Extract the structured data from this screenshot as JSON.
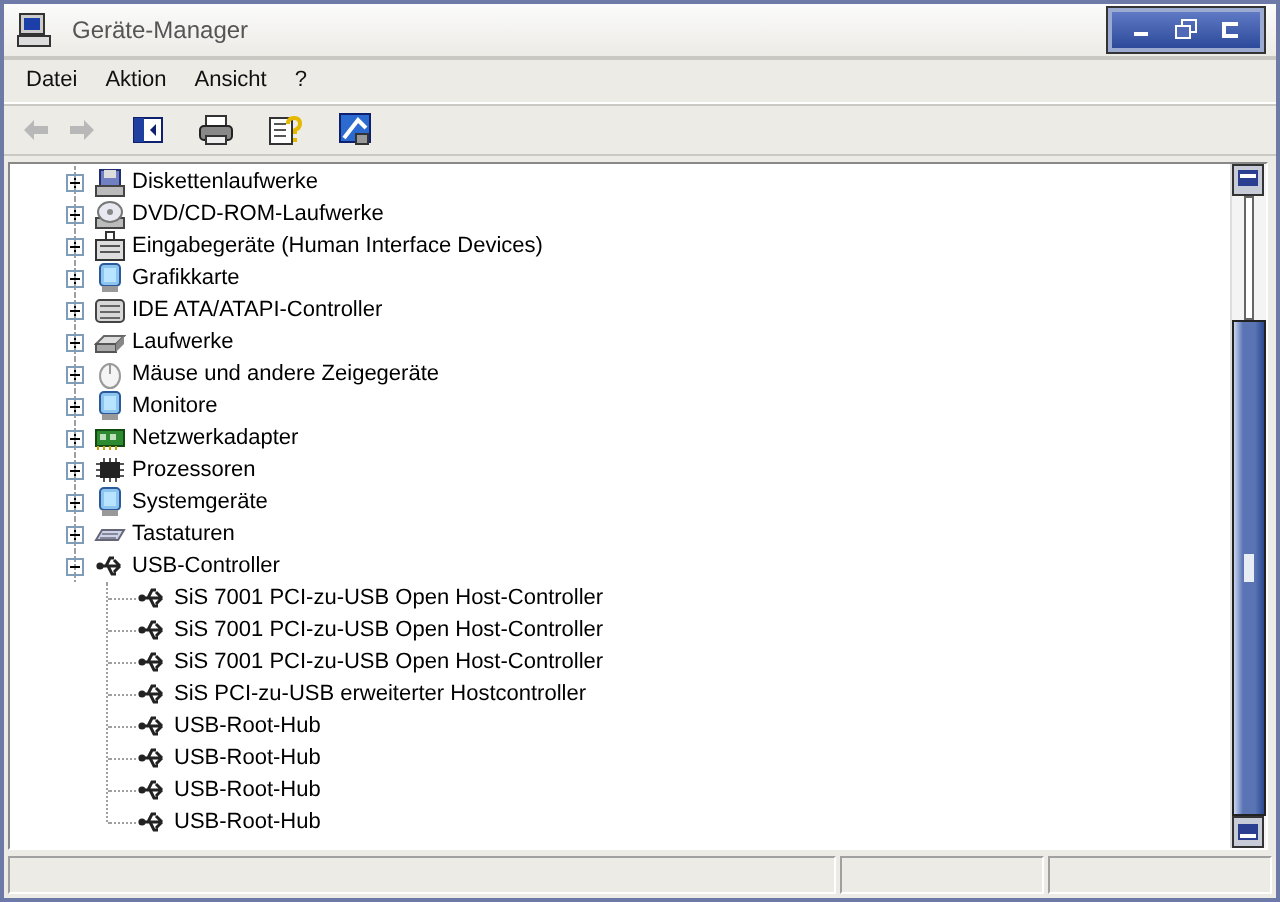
{
  "window": {
    "title": "Geräte-Manager"
  },
  "menu": [
    "Datei",
    "Aktion",
    "Ansicht",
    "?"
  ],
  "tree": [
    {
      "label": "Diskettenlaufwerke",
      "expanded": false
    },
    {
      "label": "DVD/CD-ROM-Laufwerke",
      "expanded": false
    },
    {
      "label": "Eingabegeräte (Human Interface Devices)",
      "expanded": false
    },
    {
      "label": "Grafikkarte",
      "expanded": false
    },
    {
      "label": "IDE ATA/ATAPI-Controller",
      "expanded": false
    },
    {
      "label": "Laufwerke",
      "expanded": false
    },
    {
      "label": "Mäuse und andere Zeigegeräte",
      "expanded": false
    },
    {
      "label": "Monitore",
      "expanded": false
    },
    {
      "label": "Netzwerkadapter",
      "expanded": false
    },
    {
      "label": "Prozessoren",
      "expanded": false
    },
    {
      "label": "Systemgeräte",
      "expanded": false
    },
    {
      "label": "Tastaturen",
      "expanded": false
    },
    {
      "label": "USB-Controller",
      "expanded": true,
      "children": [
        {
          "label": "SiS 7001 PCI-zu-USB Open Host-Controller"
        },
        {
          "label": "SiS 7001 PCI-zu-USB Open Host-Controller"
        },
        {
          "label": "SiS 7001 PCI-zu-USB Open Host-Controller"
        },
        {
          "label": "SiS PCI-zu-USB erweiterter Hostcontroller"
        },
        {
          "label": "USB-Root-Hub"
        },
        {
          "label": "USB-Root-Hub"
        },
        {
          "label": "USB-Root-Hub"
        },
        {
          "label": "USB-Root-Hub"
        }
      ]
    }
  ]
}
